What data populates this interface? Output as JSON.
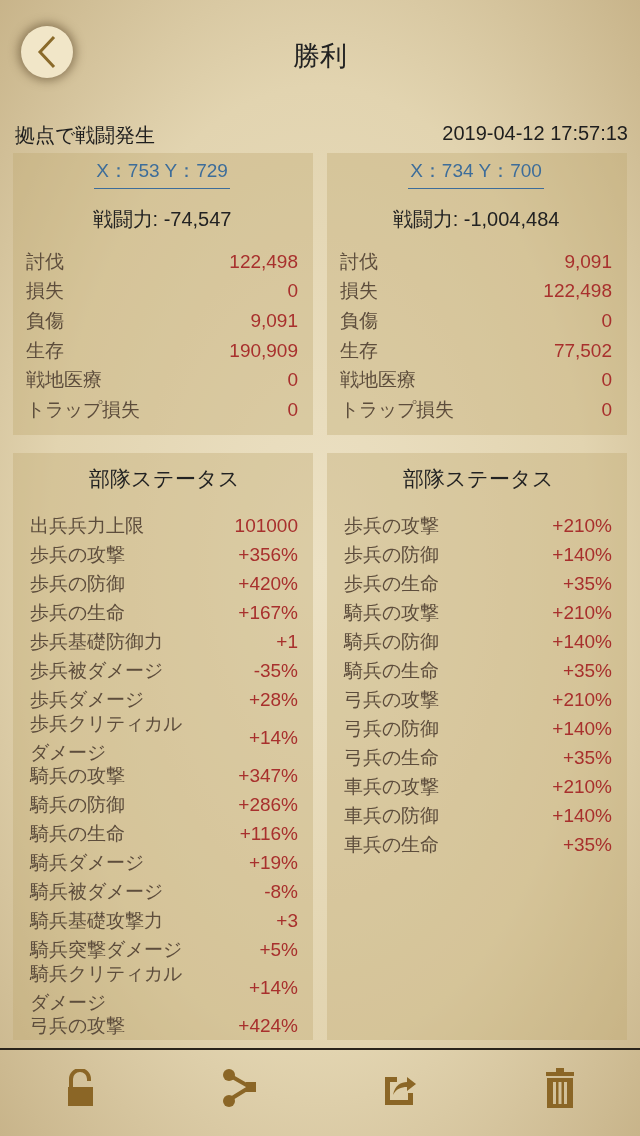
{
  "header": {
    "title": "勝利"
  },
  "battle": {
    "location_label": "拠点で戦闘発生",
    "timestamp": "2019-04-12  17:57:13"
  },
  "sides": [
    {
      "coords": "X：753 Y：729",
      "power": "戦闘力: -74,547",
      "stats": [
        {
          "label": "討伐",
          "value": "122,498"
        },
        {
          "label": "損失",
          "value": "0"
        },
        {
          "label": "負傷",
          "value": "9,091"
        },
        {
          "label": "生存",
          "value": "190,909"
        },
        {
          "label": "戦地医療",
          "value": "0"
        },
        {
          "label": "トラップ損失",
          "value": "0"
        }
      ],
      "status_title": "部隊ステータス",
      "status": [
        {
          "label": "出兵兵力上限",
          "value": "101000"
        },
        {
          "label": "歩兵の攻撃",
          "value": "+356%"
        },
        {
          "label": "歩兵の防御",
          "value": "+420%"
        },
        {
          "label": "歩兵の生命",
          "value": "+167%"
        },
        {
          "label": "歩兵基礎防御力",
          "value": "+1"
        },
        {
          "label": "歩兵被ダメージ",
          "value": "-35%"
        },
        {
          "label": "歩兵ダメージ",
          "value": "+28%"
        },
        {
          "label": "歩兵クリティカルダメージ",
          "value": "+14%"
        },
        {
          "label": "騎兵の攻撃",
          "value": "+347%"
        },
        {
          "label": "騎兵の防御",
          "value": "+286%"
        },
        {
          "label": "騎兵の生命",
          "value": "+116%"
        },
        {
          "label": "騎兵ダメージ",
          "value": "+19%"
        },
        {
          "label": "騎兵被ダメージ",
          "value": "-8%"
        },
        {
          "label": "騎兵基礎攻撃力",
          "value": "+3"
        },
        {
          "label": "騎兵突撃ダメージ",
          "value": "+5%"
        },
        {
          "label": "騎兵クリティカルダメージ",
          "value": "+14%"
        },
        {
          "label": "弓兵の攻撃",
          "value": "+424%"
        }
      ]
    },
    {
      "coords": "X：734 Y：700",
      "power": "戦闘力: -1,004,484",
      "stats": [
        {
          "label": "討伐",
          "value": "9,091"
        },
        {
          "label": "損失",
          "value": "122,498"
        },
        {
          "label": "負傷",
          "value": "0"
        },
        {
          "label": "生存",
          "value": "77,502"
        },
        {
          "label": "戦地医療",
          "value": "0"
        },
        {
          "label": "トラップ損失",
          "value": "0"
        }
      ],
      "status_title": "部隊ステータス",
      "status": [
        {
          "label": "歩兵の攻撃",
          "value": "+210%"
        },
        {
          "label": "歩兵の防御",
          "value": "+140%"
        },
        {
          "label": "歩兵の生命",
          "value": "+35%"
        },
        {
          "label": "騎兵の攻撃",
          "value": "+210%"
        },
        {
          "label": "騎兵の防御",
          "value": "+140%"
        },
        {
          "label": "騎兵の生命",
          "value": "+35%"
        },
        {
          "label": "弓兵の攻撃",
          "value": "+210%"
        },
        {
          "label": "弓兵の防御",
          "value": "+140%"
        },
        {
          "label": "弓兵の生命",
          "value": "+35%"
        },
        {
          "label": "車兵の攻撃",
          "value": "+210%"
        },
        {
          "label": "車兵の防御",
          "value": "+140%"
        },
        {
          "label": "車兵の生命",
          "value": "+35%"
        }
      ]
    }
  ],
  "toolbar": [
    {
      "kind": "lock"
    },
    {
      "kind": "share"
    },
    {
      "kind": "export"
    },
    {
      "kind": "trash"
    }
  ]
}
